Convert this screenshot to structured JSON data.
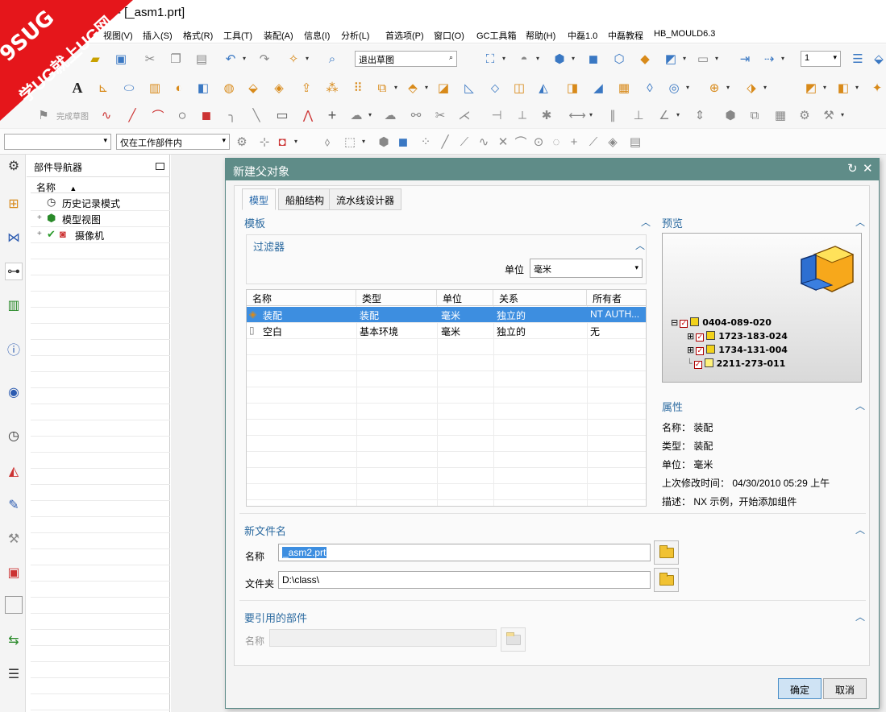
{
  "window": {
    "title": "- [_asm1.prt]"
  },
  "watermark": {
    "line1": "9SUG",
    "line2": "学UG就上UG网"
  },
  "menu": [
    "视图(V)",
    "插入(S)",
    "格式(R)",
    "工具(T)",
    "装配(A)",
    "信息(I)",
    "分析(L)",
    "首选项(P)",
    "窗口(O)",
    "GC工具箱",
    "帮助(H)",
    "中磊1.0",
    "中磊教程",
    "HB_MOULD6.3"
  ],
  "toolbar": {
    "exit_sketch_label": "退出草图",
    "count_value": "1",
    "finish_sketch_label": "完成草图",
    "filter_value": "",
    "scope_value": "仅在工作部件内"
  },
  "navigator": {
    "title": "部件导航器",
    "column": "名称",
    "items": [
      "历史记录模式",
      "模型视图",
      "摄像机"
    ]
  },
  "dialog": {
    "title": "新建父对象",
    "tabs": [
      "模型",
      "船舶结构",
      "流水线设计器"
    ],
    "template_section": "模板",
    "filter_section": "过滤器",
    "unit_label": "单位",
    "unit_value": "毫米",
    "columns": [
      "名称",
      "类型",
      "单位",
      "关系",
      "所有者"
    ],
    "rows": [
      {
        "name": "装配",
        "type": "装配",
        "unit": "毫米",
        "relation": "独立的",
        "owner": "NT AUTH...",
        "selected": true
      },
      {
        "name": "空白",
        "type": "基本环境",
        "unit": "毫米",
        "relation": "独立的",
        "owner": "无",
        "selected": false
      }
    ],
    "preview_section": "预览",
    "preview_tree": [
      "0404-089-020",
      "1723-183-024",
      "1734-131-004",
      "2211-273-011"
    ],
    "properties_section": "属性",
    "properties": {
      "name": "名称： 装配",
      "type": "类型： 装配",
      "unit": "单位： 毫米",
      "modified": "上次修改时间： 04/30/2010 05:29 上午",
      "description": "描述： NX 示例，开始添加组件"
    },
    "new_file_section": "新文件名",
    "name_label": "名称",
    "name_value": "_asm2.prt",
    "folder_label": "文件夹",
    "folder_value": "D:\\class\\",
    "ref_section": "要引用的部件",
    "ref_name_label": "名称",
    "ok_label": "确定",
    "cancel_label": "取消"
  }
}
